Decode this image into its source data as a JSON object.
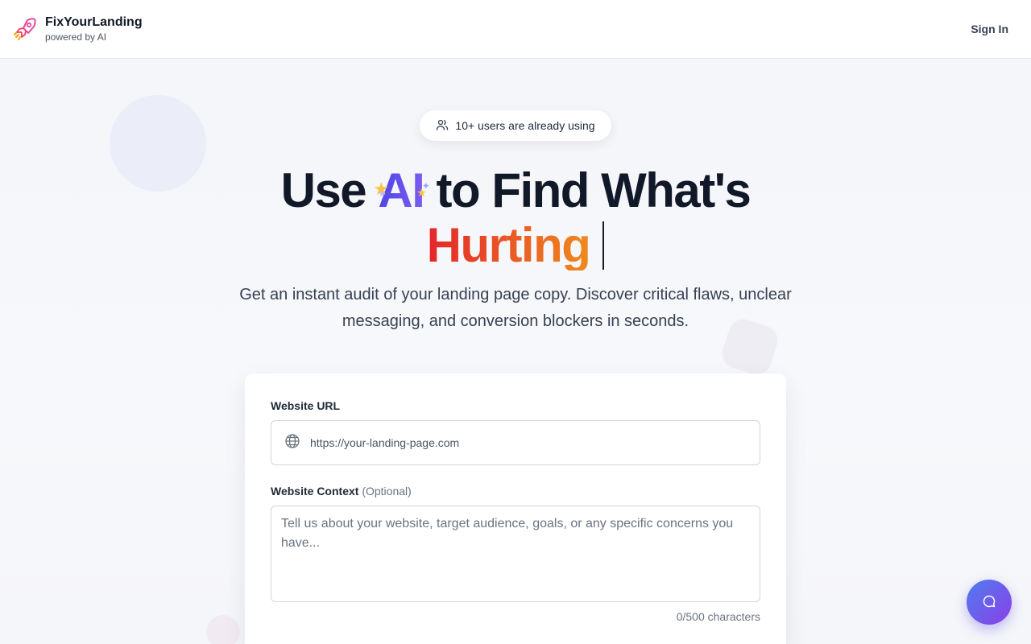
{
  "header": {
    "brand_name": "FixYourLanding",
    "brand_sub": "powered by AI",
    "signin_label": "Sign In"
  },
  "badge": {
    "text": "10+ users are already using",
    "icon": "users-icon"
  },
  "headline": {
    "part1": "Use ",
    "ai": "AI",
    "part2": " to Find What's",
    "highlight": "Hurting"
  },
  "subtitle": "Get an instant audit of your landing page copy. Discover critical flaws, unclear messaging, and conversion blockers in seconds.",
  "form": {
    "url_label": "Website URL",
    "url_placeholder": "https://your-landing-page.com",
    "context_label": "Website Context",
    "context_optional": "(Optional)",
    "context_placeholder": "Tell us about your website, target audience, goals, or any specific concerns you have...",
    "counter": "0/500 characters"
  },
  "icons": {
    "logo": "rocket-icon",
    "url": "globe-icon",
    "chat": "chat-bubble-icon"
  },
  "colors": {
    "ai_gradient_start": "#4f46e5",
    "hurting_gradient_start": "#e3262a",
    "hurting_gradient_end": "#f08a1e",
    "chat_gradient_start": "#4f7df0",
    "chat_gradient_end": "#8b3fe8"
  }
}
